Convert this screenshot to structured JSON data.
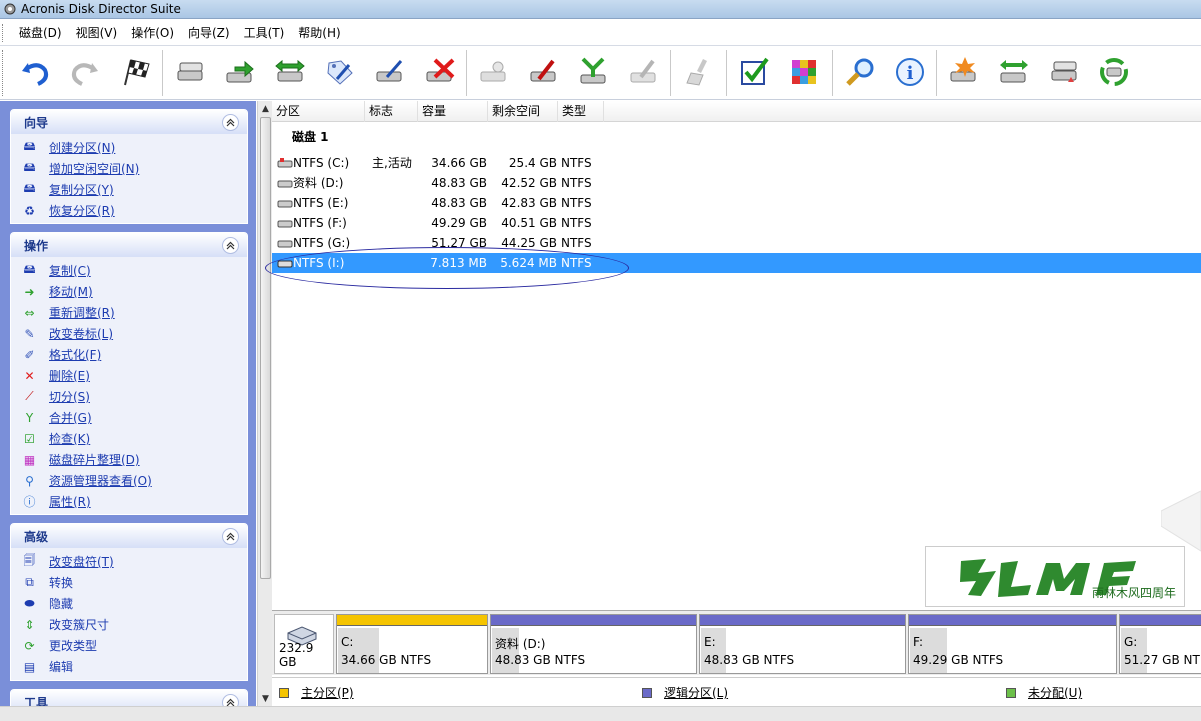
{
  "window": {
    "title": "Acronis Disk Director Suite"
  },
  "menu": [
    "磁盘(D)",
    "视图(V)",
    "操作(O)",
    "向导(Z)",
    "工具(T)",
    "帮助(H)"
  ],
  "toolbar": {
    "buttons": [
      "undo",
      "redo",
      "commit",
      "copy",
      "move",
      "resize",
      "change-label",
      "format",
      "delete",
      "split",
      "merge",
      "check",
      "defragment",
      "explore",
      "properties",
      "change-letter",
      "convert",
      "recovery"
    ]
  },
  "sidebar": {
    "groups": [
      {
        "title": "向导",
        "items": [
          {
            "label": "创建分区(N)",
            "icon": "create-partition-icon"
          },
          {
            "label": "增加空闲空间(N)",
            "icon": "add-space-icon"
          },
          {
            "label": "复制分区(Y)",
            "icon": "copy-partition-icon"
          },
          {
            "label": "恢复分区(R)",
            "icon": "recover-partition-icon"
          }
        ]
      },
      {
        "title": "操作",
        "items": [
          {
            "label": "复制(C)",
            "icon": "copy-icon"
          },
          {
            "label": "移动(M)",
            "icon": "move-icon"
          },
          {
            "label": "重新调整(R)",
            "icon": "resize-icon"
          },
          {
            "label": "改变卷标(L)",
            "icon": "label-icon"
          },
          {
            "label": "格式化(F)",
            "icon": "format-icon"
          },
          {
            "label": "删除(E)",
            "icon": "delete-icon"
          },
          {
            "label": "切分(S)",
            "icon": "split-icon"
          },
          {
            "label": "合并(G)",
            "icon": "merge-icon"
          },
          {
            "label": "检查(K)",
            "icon": "check-icon"
          },
          {
            "label": "磁盘碎片整理(D)",
            "icon": "defrag-icon"
          },
          {
            "label": "资源管理器查看(O)",
            "icon": "explorer-icon"
          },
          {
            "label": "属性(R)",
            "icon": "info-icon"
          }
        ]
      },
      {
        "title": "高级",
        "items": [
          {
            "label": "改变盘符(T)",
            "icon": "drive-letter-icon"
          },
          {
            "label": "转换",
            "icon": "convert-icon"
          },
          {
            "label": "隐藏",
            "icon": "hide-icon"
          },
          {
            "label": "改变簇尺寸",
            "icon": "cluster-icon"
          },
          {
            "label": "更改类型",
            "icon": "change-type-icon"
          },
          {
            "label": "编辑",
            "icon": "edit-icon"
          }
        ]
      },
      {
        "title": "工具"
      }
    ]
  },
  "table": {
    "columns": [
      "分区",
      "标志",
      "容量",
      "剩余空间",
      "类型"
    ],
    "disk_label": "磁盘 1",
    "rows": [
      {
        "name": "NTFS (C:)",
        "flags": "主,活动",
        "capacity": "34.66 GB",
        "free": "25.4 GB",
        "type": "NTFS"
      },
      {
        "name": "资料 (D:)",
        "flags": "",
        "capacity": "48.83 GB",
        "free": "42.52 GB",
        "type": "NTFS"
      },
      {
        "name": "NTFS (E:)",
        "flags": "",
        "capacity": "48.83 GB",
        "free": "42.83 GB",
        "type": "NTFS"
      },
      {
        "name": "NTFS (F:)",
        "flags": "",
        "capacity": "49.29 GB",
        "free": "40.51 GB",
        "type": "NTFS"
      },
      {
        "name": "NTFS (G:)",
        "flags": "",
        "capacity": "51.27 GB",
        "free": "44.25 GB",
        "type": "NTFS"
      },
      {
        "name": "NTFS (I:)",
        "flags": "",
        "capacity": "7.813 MB",
        "free": "5.624 MB",
        "type": "NTFS",
        "selected": true
      }
    ]
  },
  "watermark": {
    "text": "雨林木风四周年"
  },
  "diskmap": {
    "disk_size": "232.9 GB",
    "partitions": [
      {
        "label": "C:",
        "size": "34.66 GB  NTFS",
        "kind": "primary",
        "used": 0.27
      },
      {
        "label": "资料 (D:)",
        "size": "48.83 GB  NTFS",
        "kind": "logical",
        "used": 0.13
      },
      {
        "label": "E:",
        "size": "48.83 GB  NTFS",
        "kind": "logical",
        "used": 0.12
      },
      {
        "label": "F:",
        "size": "49.29 GB  NTFS",
        "kind": "logical",
        "used": 0.18
      },
      {
        "label": "G:",
        "size": "51.27 GB  NTFS",
        "kind": "logical",
        "used": 0.14
      }
    ]
  },
  "legend": [
    {
      "label": "主分区(P)",
      "color": "#f5c400"
    },
    {
      "label": "逻辑分区(L)",
      "color": "#6a6ac8"
    },
    {
      "label": "未分配(U)",
      "color": "#6cc04a"
    }
  ],
  "colors": {
    "primary": "#f5c400",
    "logical": "#6a6ac8",
    "selection": "#3399ff",
    "sidebar_bg": "#7a8fd9"
  }
}
